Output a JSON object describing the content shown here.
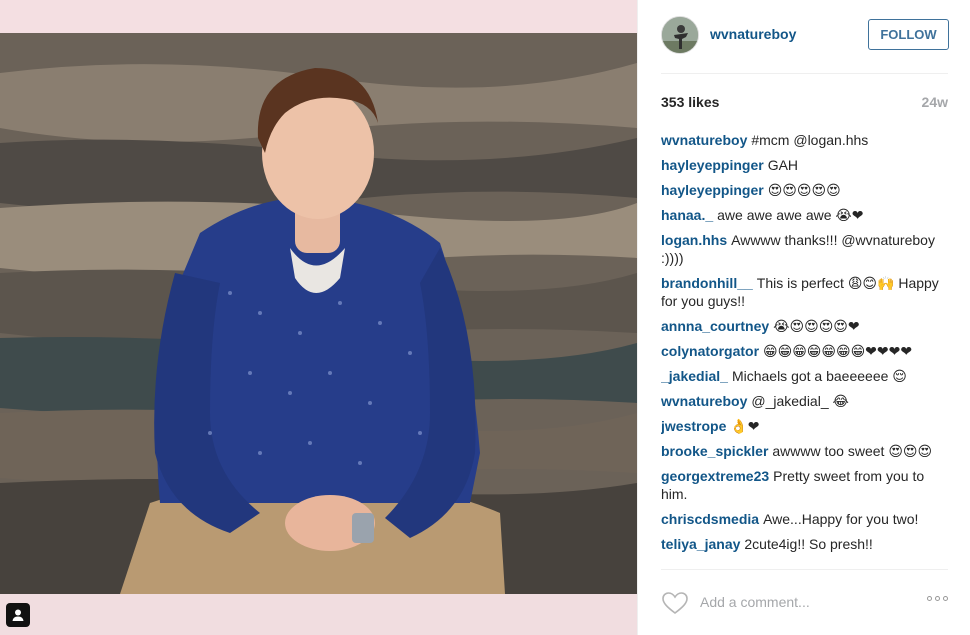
{
  "post": {
    "username": "wvnatureboy",
    "follow_label": "FOLLOW",
    "likes": "353 likes",
    "age": "24w",
    "add_comment_placeholder": "Add a comment..."
  },
  "comments": [
    {
      "author": "wvnatureboy",
      "text": "#mcm @logan.hhs"
    },
    {
      "author": "hayleyeppinger",
      "text": "GAH"
    },
    {
      "author": "hayleyeppinger",
      "text": "😍😍😍😍😍"
    },
    {
      "author": "hanaa._",
      "text": "awe awe awe awe 😭❤"
    },
    {
      "author": "logan.hhs",
      "text": "Awwww thanks!!! @wvnatureboy :))))"
    },
    {
      "author": "brandonhill__",
      "text": "This is perfect 😩😊🙌 Happy for you guys!!"
    },
    {
      "author": "annna_courtney",
      "text": "😭😍😍😍😍❤"
    },
    {
      "author": "colynatorgator",
      "text": "😁😁😁😁😁😁😁❤❤❤❤"
    },
    {
      "author": "_jakedial_",
      "text": "Michaels got a baeeeeee 😌"
    },
    {
      "author": "wvnatureboy",
      "text": "@_jakedial_ 😂"
    },
    {
      "author": "jwestrope",
      "text": "👌❤"
    },
    {
      "author": "brooke_spickler",
      "text": "awwww too sweet 😍😍😍"
    },
    {
      "author": "georgextreme23",
      "text": "Pretty sweet from you to him."
    },
    {
      "author": "chriscdsmedia",
      "text": "Awe...Happy for you two!"
    },
    {
      "author": "teliya_janay",
      "text": "2cute4ig!! So presh!!"
    }
  ],
  "icons": {
    "avatar": "avatar-image",
    "tag": "person-tag-icon",
    "heart": "heart-outline-icon",
    "more": "more-options-icon"
  },
  "colors": {
    "link": "#125688",
    "follow_border": "#3f729b",
    "muted": "#a5a7aa",
    "photo_bg": "#f4dfe2"
  }
}
